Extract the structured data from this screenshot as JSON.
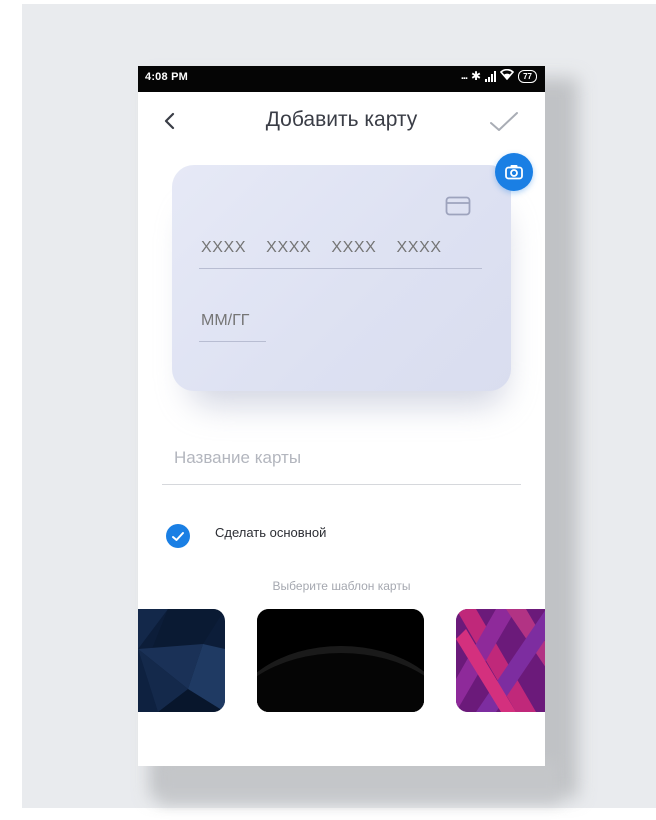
{
  "status_bar": {
    "time": "4:08 PM",
    "signal_dots": "...",
    "battery_level": "77"
  },
  "header": {
    "title": "Добавить карту",
    "back_icon": "chevron-left-icon",
    "confirm_icon": "checkmark-icon"
  },
  "scan_button": {
    "icon": "camera-icon",
    "color": "#1a7fe4"
  },
  "card_preview": {
    "number_placeholder": "XXXX  XXXX  XXXX  XXXX",
    "expiry_placeholder": "ММ/ГГ",
    "card_icon": "credit-card-icon"
  },
  "form": {
    "name_placeholder": "Название карты",
    "make_default_label": "Сделать основной",
    "make_default_checked": true
  },
  "templates": {
    "title": "Выберите шаблон карты",
    "items": [
      {
        "name": "dark-blue-polygon",
        "color": "#0c1d39"
      },
      {
        "name": "black-horizon",
        "color": "#000000"
      },
      {
        "name": "purple-pattern",
        "color": "#6b1a7a"
      }
    ]
  },
  "colors": {
    "accent": "#1a7fe4",
    "title_text": "#3a3d46",
    "placeholder": "#b3b6be"
  }
}
